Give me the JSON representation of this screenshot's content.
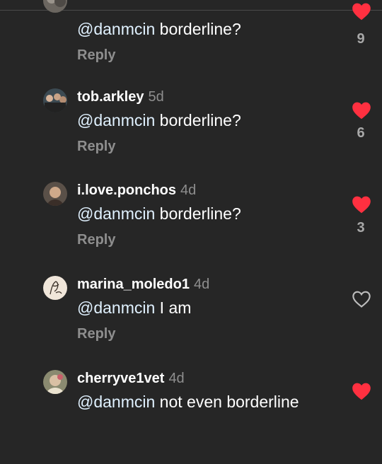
{
  "colors": {
    "background": "#262626",
    "like_active": "#ff3040",
    "muted": "#8e8e8e"
  },
  "comments": [
    {
      "username": "",
      "time": "",
      "mention": "@danmcin",
      "text": " borderline?",
      "reply": "Reply",
      "liked": true,
      "likes": "9",
      "avatar_icon": "avatar-photo-icon"
    },
    {
      "username": "tob.arkley",
      "time": "5d",
      "mention": "@danmcin",
      "text": " borderline?",
      "reply": "Reply",
      "liked": true,
      "likes": "6",
      "avatar_icon": "avatar-group-photo-icon"
    },
    {
      "username": "i.love.ponchos",
      "time": "4d",
      "mention": "@danmcin",
      "text": " borderline?",
      "reply": "Reply",
      "liked": true,
      "likes": "3",
      "avatar_icon": "avatar-photo-icon"
    },
    {
      "username": "marina_moledo1",
      "time": "4d",
      "mention": "@danmcin",
      "text": " I am",
      "reply": "Reply",
      "liked": false,
      "likes": "",
      "avatar_icon": "avatar-line-art-icon"
    },
    {
      "username": "cherryve1vet",
      "time": "4d",
      "mention": "@danmcin",
      "text": " not even borderline",
      "reply": "",
      "liked": true,
      "likes": "",
      "avatar_icon": "avatar-photo-icon"
    }
  ]
}
